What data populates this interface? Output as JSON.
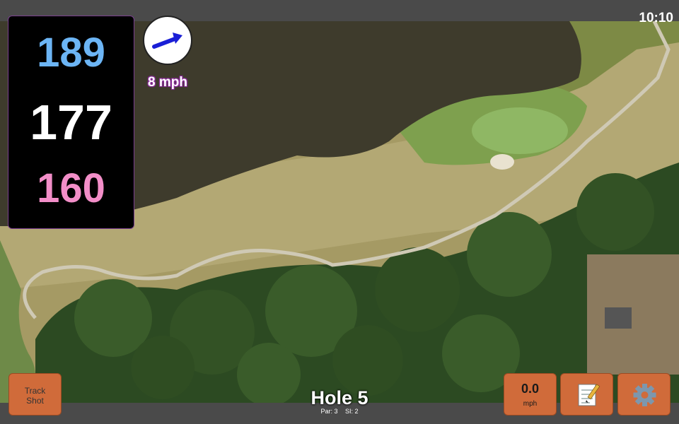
{
  "status_bar": {
    "time": "10:10"
  },
  "distances": {
    "back": "189",
    "middle": "177",
    "front": "160"
  },
  "wind": {
    "speed": "8 mph",
    "direction_icon": "arrow-icon"
  },
  "hole": {
    "title": "Hole 5",
    "par": "Par: 3",
    "si": "SI: 2"
  },
  "buttons": {
    "track_shot": {
      "line1": "Track",
      "line2": "Shot"
    },
    "speed": {
      "value": "0.0",
      "unit": "mph"
    },
    "notes_icon": "notepad-icon",
    "settings_icon": "gear-icon"
  },
  "colors": {
    "back_distance": "#6cb5f5",
    "middle_distance": "#ffffff",
    "front_distance": "#f28ec8",
    "button": "#d06b3a",
    "panel_border": "#7a3f8f"
  }
}
